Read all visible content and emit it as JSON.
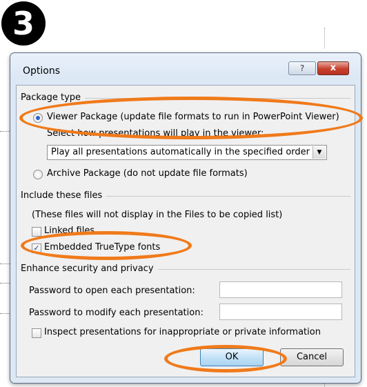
{
  "step_marker": "3",
  "dialog": {
    "title": "Options",
    "help_label": "?",
    "close_label": "x"
  },
  "package_type": {
    "heading": "Package type",
    "viewer_option": "Viewer Package (update file formats to run in PowerPoint Viewer)",
    "viewer_selected": true,
    "play_prompt": "Select how presentations will play in the viewer:",
    "play_selected_value": "Play all presentations automatically in the specified order",
    "archive_option": "Archive Package (do not update file formats)",
    "archive_selected": false
  },
  "include_files": {
    "heading": "Include these files",
    "note": "(These files will not display in the Files to be copied list)",
    "linked_files_label": "Linked files",
    "linked_files_checked": false,
    "embedded_fonts_label": "Embedded TrueType fonts",
    "embedded_fonts_checked": true
  },
  "security": {
    "heading": "Enhance security and privacy",
    "open_password_label": "Password to open each presentation:",
    "open_password_value": "",
    "modify_password_label": "Password to modify each presentation:",
    "modify_password_value": "",
    "inspect_label": "Inspect presentations for inappropriate or private information",
    "inspect_checked": false
  },
  "buttons": {
    "ok_label": "OK",
    "cancel_label": "Cancel"
  },
  "annotation_color": "#f07a1a"
}
